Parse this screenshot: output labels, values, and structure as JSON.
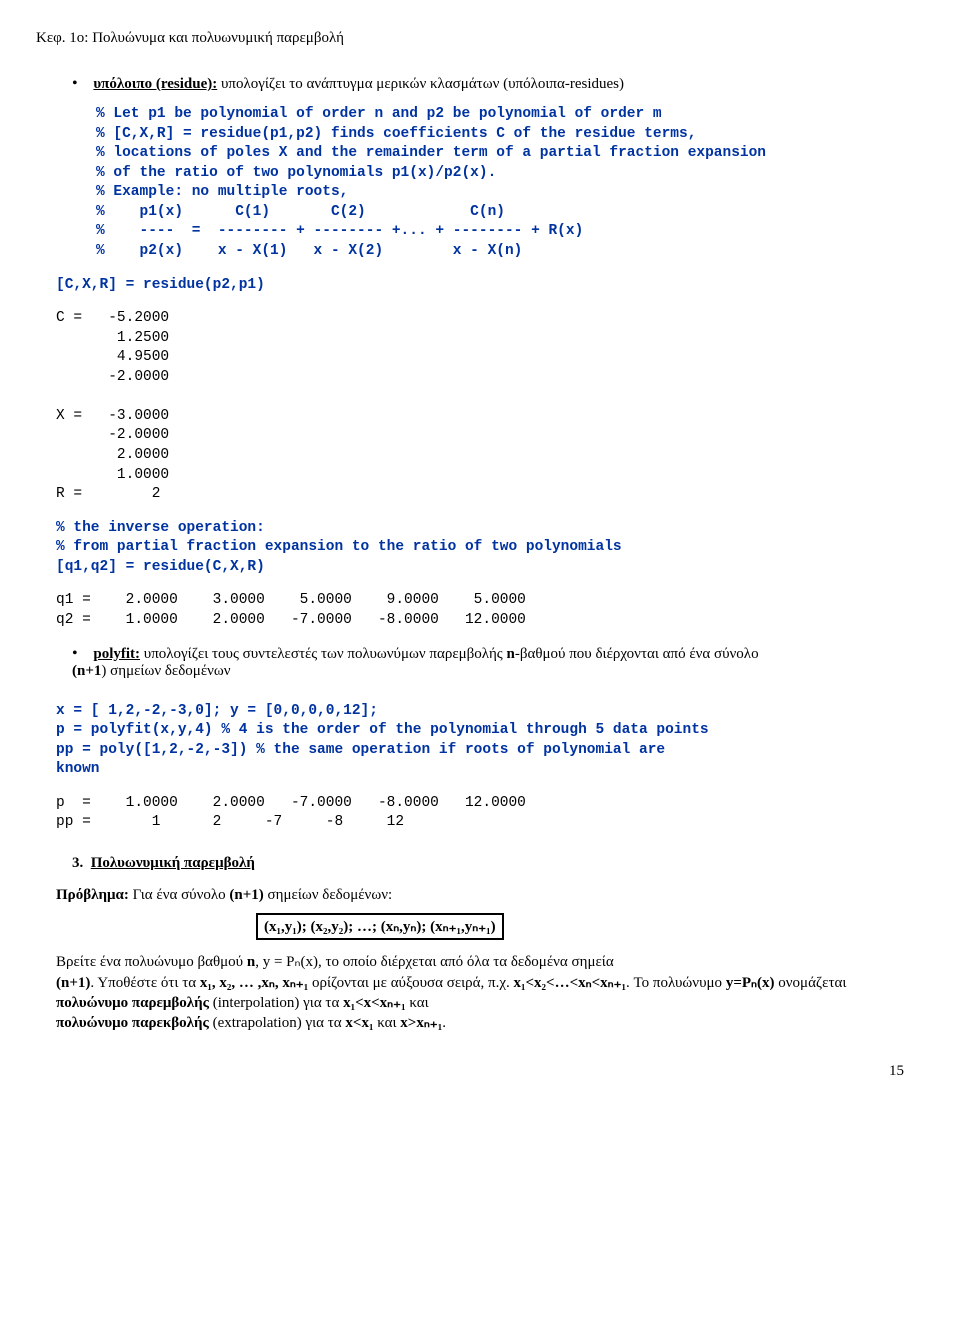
{
  "header": "Κεφ. 1ο: Πολυώνυμα και πολυωνυμική παρεμβολή",
  "bullet1_bold": "υπόλοιπο (residue):",
  "bullet1_rest": " υπολογίζει το ανάπτυγμα μερικών κλασμάτων (υπόλοιπα-residues)",
  "code1": "% Let p1 be polynomial of order n and p2 be polynomial of order m\n% [C,X,R] = residue(p1,p2) finds coefficients C of the residue terms,\n% locations of poles X and the remainder term of a partial fraction expansion\n% of the ratio of two polynomials p1(x)/p2(x).\n% Example: no multiple roots,\n%    p1(x)      C(1)       C(2)            C(n)\n%    ----  =  -------- + -------- +... + -------- + R(x)\n%    p2(x)    x - X(1)   x - X(2)        x - X(n)",
  "code2": "[C,X,R] = residue(p2,p1)",
  "result1": "C =   -5.2000\n       1.2500\n       4.9500\n      -2.0000\n\nX =   -3.0000\n      -2.0000\n       2.0000\n       1.0000\nR =        2",
  "code3": "% the inverse operation:\n% from partial fraction expansion to the ratio of two polynomials\n[q1,q2] = residue(C,X,R)",
  "result2": "q1 =    2.0000    3.0000    5.0000    9.0000    5.0000\nq2 =    1.0000    2.0000   -7.0000   -8.0000   12.0000",
  "bullet2_bold": "polyfit:",
  "bullet2_rest_a": " υπολογίζει τους συντελεστές των πολυωνύμων παρεμβολής ",
  "bullet2_rest_b": "n",
  "bullet2_rest_c": "-βαθμού που διέρχονται από ένα σύνολο ",
  "bullet2_rest_d": "(n+1",
  "bullet2_rest_e": ") σημείων δεδομένων",
  "code4": "x = [ 1,2,-2,-3,0]; y = [0,0,0,0,12];\np = polyfit(x,y,4) % 4 is the order of the polynomial through 5 data points\npp = poly([1,2,-2,-3]) % the same operation if roots of polynomial are\nknown",
  "result3": "p  =    1.0000    2.0000   -7.0000   -8.0000   12.0000\npp =       1      2     -7     -8     12",
  "section3": "Πολυωνυμική παρεμβολή",
  "problem_bold": "Πρόβλημα:",
  "problem_rest": " Για ένα σύνολο ",
  "problem_b": "(n+1)",
  "problem_c": " σημείων δεδομένων:",
  "boxed_text": "(x₁,y₁); (x₂,y₂); …; (xₙ,yₙ); (xₙ₊₁,yₙ₊₁)",
  "para_final_1a": "Βρείτε ένα πολυώνυμο βαθμού  ",
  "para_final_1b": "n",
  "para_final_1c": ", y = Pₙ(x), το οποίο  διέρχεται από όλα τα  δεδομένα σημεία ",
  "para_final_2a": "(n+1)",
  "para_final_2b": ". Υποθέστε ότι  τα ",
  "para_final_2c": "x₁, x₂, … ,xₙ, xₙ₊₁",
  "para_final_2d": " ορίζονται με αύξουσα  σειρά, π.χ.",
  "para_final_2e": " x₁<x₂<…<xₙ<xₙ₊₁",
  "para_final_3a": ". Το πολυώνυμο ",
  "para_final_3b": "y=Pₙ(x)",
  "para_final_3c": " ονομάζεται ",
  "para_final_3d": "πολυώνυμο παρεμβολής",
  "para_final_3e": " (interpolation) για τα ",
  "para_final_3f": "x₁<x<xₙ₊₁",
  "para_final_3g": " και ",
  "para_final_4a": "πολυώνυμο παρεκβολής",
  "para_final_4b": " (extrapolation) για τα ",
  "para_final_4c": "x<x₁",
  "para_final_4d": " και ",
  "para_final_4e": "x>xₙ₊₁",
  "page_number": "15"
}
